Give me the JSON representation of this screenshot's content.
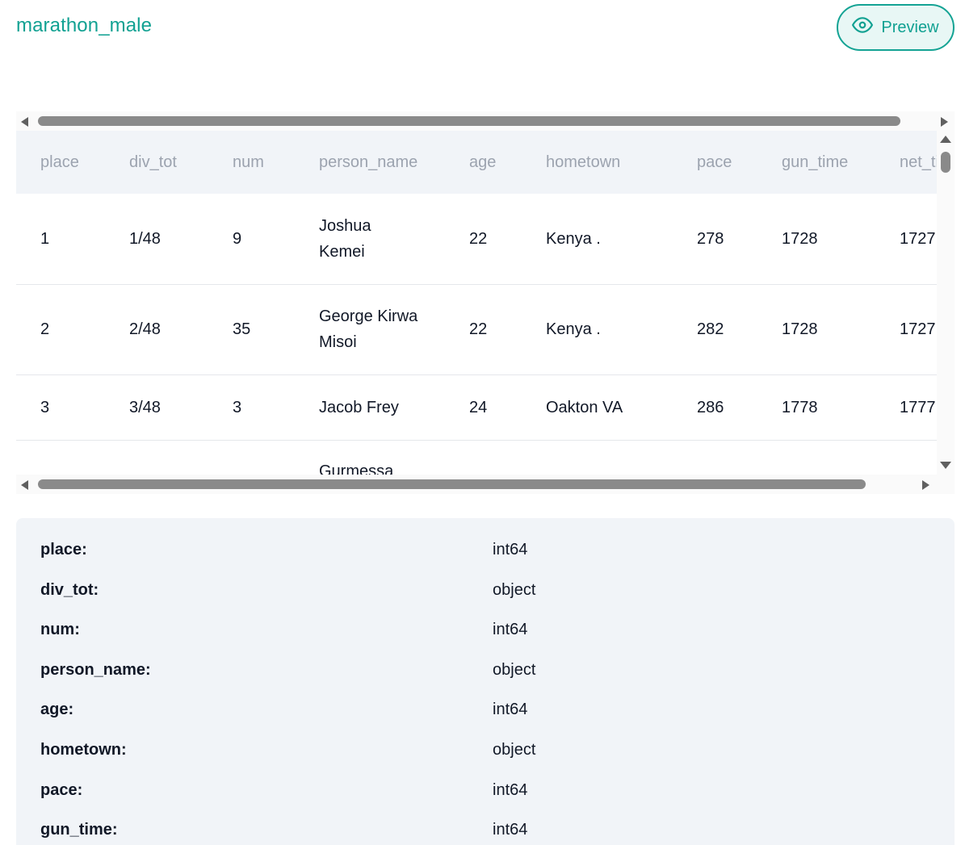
{
  "dataset": {
    "title": "marathon_male"
  },
  "preview_button": {
    "label": "Preview",
    "icon": "eye-icon"
  },
  "table": {
    "columns": [
      "place",
      "div_tot",
      "num",
      "person_name",
      "age",
      "hometown",
      "pace",
      "gun_time",
      "net_time"
    ],
    "rows": [
      [
        "1",
        "1/48",
        "9",
        "Joshua Kemei",
        "22",
        "Kenya .",
        "278",
        "1728",
        "1727"
      ],
      [
        "2",
        "2/48",
        "35",
        "George Kirwa Misoi",
        "22",
        "Kenya .",
        "282",
        "1728",
        "1727"
      ],
      [
        "3",
        "3/48",
        "3",
        "Jacob Frey",
        "24",
        "Oakton VA",
        "286",
        "1778",
        "1777"
      ],
      [
        "",
        "",
        "",
        "Gurmessa",
        "",
        "",
        "",
        "",
        ""
      ]
    ]
  },
  "dtypes": [
    {
      "name": "place:",
      "type": "int64"
    },
    {
      "name": "div_tot:",
      "type": "object"
    },
    {
      "name": "num:",
      "type": "int64"
    },
    {
      "name": "person_name:",
      "type": "object"
    },
    {
      "name": "age:",
      "type": "int64"
    },
    {
      "name": "hometown:",
      "type": "object"
    },
    {
      "name": "pace:",
      "type": "int64"
    },
    {
      "name": "gun_time:",
      "type": "int64"
    }
  ],
  "colors": {
    "accent": "#11a192",
    "panel_bg": "#f1f4f8",
    "header_text": "#9ca3af"
  }
}
